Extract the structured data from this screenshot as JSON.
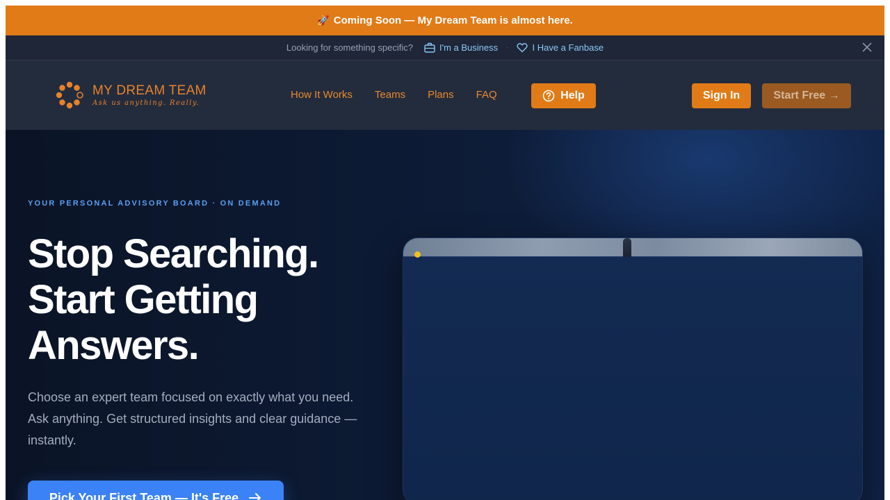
{
  "banner": {
    "rocket_icon": "rocket-icon",
    "text": "Coming Soon — My Dream Team is almost here."
  },
  "strip": {
    "question": "Looking for something specific?",
    "business_link": "I'm a Business",
    "fanbase_link": "I Have a Fanbase",
    "separator": "·",
    "icons": [
      "briefcase-icon",
      "heart-icon",
      "close-icon"
    ]
  },
  "nav": {
    "logo_title": "MY DREAM TEAM",
    "logo_tagline": "Ask us anything. Really.",
    "links": [
      "How It Works",
      "Teams",
      "Plans",
      "FAQ"
    ],
    "help_label": "Help",
    "signin_label": "Sign In",
    "startfree_label": "Start Free →",
    "colors": {
      "accent": "#e07b17",
      "start_free_bg": "#9a5a22"
    }
  },
  "hero": {
    "eyebrow": "YOUR PERSONAL ADVISORY BOARD · ON DEMAND",
    "headline": [
      "Stop Searching.",
      "Start Getting",
      "Answers."
    ],
    "subtext": "Choose an expert team focused on exactly what you need. Ask anything. Get structured insights and clear guidance — instantly.",
    "cta_label": "Pick Your First Team — It's Free",
    "colors": {
      "eyebrow": "#5a9ff0",
      "cta": "#3b82f6"
    }
  }
}
